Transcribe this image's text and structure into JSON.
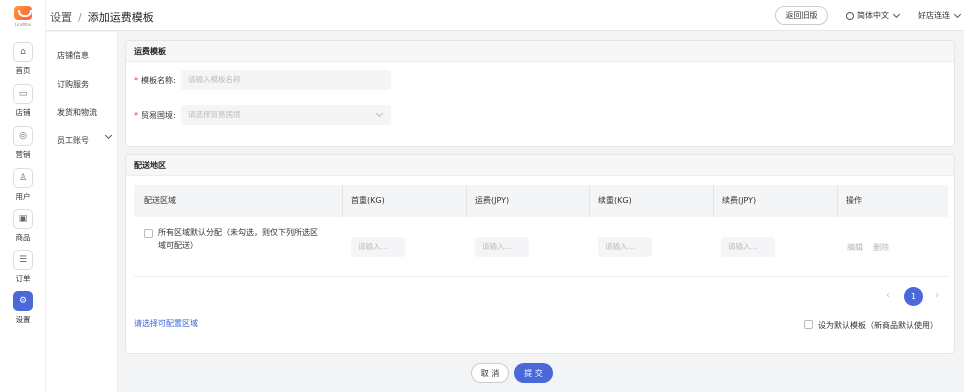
{
  "logo": {
    "text": "LinkMax"
  },
  "rail": {
    "items": [
      {
        "label": "首页",
        "icon": "home-icon",
        "glyph": "⌂"
      },
      {
        "label": "店铺",
        "icon": "store-icon",
        "glyph": "▭"
      },
      {
        "label": "营销",
        "icon": "marketing-icon",
        "glyph": "◎"
      },
      {
        "label": "用户",
        "icon": "user-icon",
        "glyph": "♙"
      },
      {
        "label": "商品",
        "icon": "product-icon",
        "glyph": "▣"
      },
      {
        "label": "订单",
        "icon": "order-icon",
        "glyph": "☰"
      },
      {
        "label": "设置",
        "icon": "settings-icon",
        "glyph": "⚙"
      }
    ],
    "active": "设置"
  },
  "header": {
    "breadcrumb_parent": "设置",
    "breadcrumb_sep": "/",
    "breadcrumb_current": "添加运费模板",
    "back_old_label": "返回旧版",
    "language": "简体中文",
    "user": "好店连连"
  },
  "subnav": {
    "items": [
      {
        "label": "店铺信息"
      },
      {
        "label": "订购服务"
      },
      {
        "label": "发货和物流"
      },
      {
        "label": "员工账号"
      }
    ]
  },
  "template_panel": {
    "title": "运费模板",
    "name_label": "模板名称:",
    "name_placeholder": "请输入模板名称",
    "country_label": "贸易国境:",
    "country_placeholder": "请选择贸易国境"
  },
  "delivery_panel": {
    "title": "配送地区",
    "columns": [
      "配送区域",
      "首重(KG)",
      "运费(JPY)",
      "续重(KG)",
      "续费(JPY)",
      "操作"
    ],
    "row": {
      "region_text_line1": "所有区域默认分配（未勾选，则仅下列所选区",
      "region_text_line2": "域可配送）",
      "placeholder": "请输入...",
      "edit": "编辑",
      "delete": "删除"
    },
    "pagination": {
      "current_page": "1",
      "prev": "‹",
      "next": "›"
    },
    "select_region_link": "请选择可配置区域",
    "default_template_label": "设为默认模板（新商品默认使用）"
  },
  "footer": {
    "cancel_label": "取 消",
    "submit_label": "提 交"
  },
  "colors": {
    "accent": "#4a68d8",
    "required": "#e53935",
    "link": "#3a63d8"
  }
}
